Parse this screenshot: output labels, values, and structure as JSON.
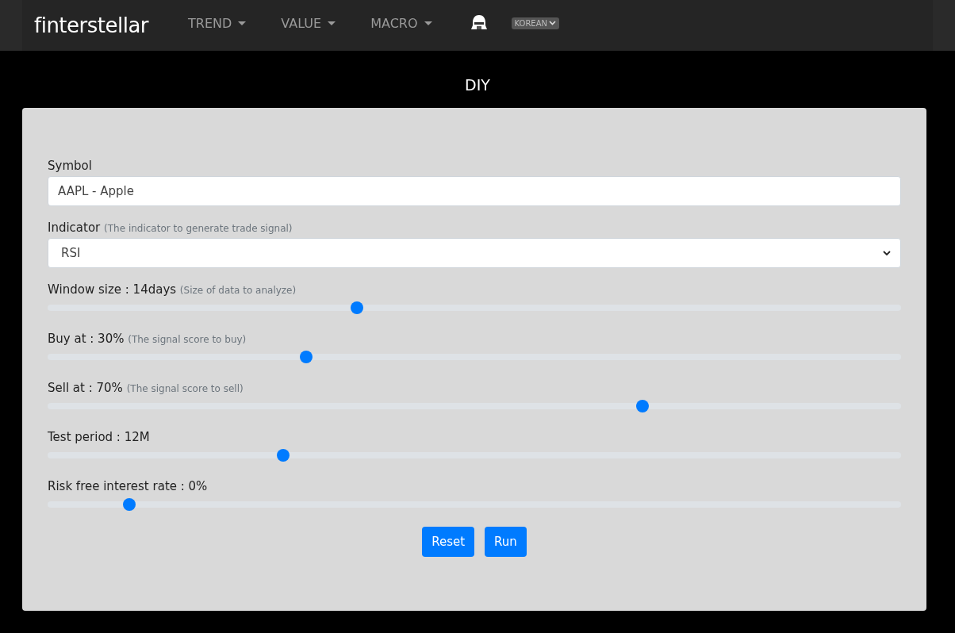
{
  "navbar": {
    "brand": "finterstellar",
    "menus": [
      {
        "label": "TREND"
      },
      {
        "label": "VALUE"
      },
      {
        "label": "MACRO"
      }
    ],
    "language": "KOREAN"
  },
  "page_title": "DIY",
  "form": {
    "symbol": {
      "label": "Symbol",
      "value": "AAPL - Apple"
    },
    "indicator": {
      "label": "Indicator",
      "hint": "(The indicator to generate trade signal)",
      "value": "RSI"
    },
    "sliders": [
      {
        "label": "Window size : 14days",
        "hint": "(Size of data to analyze)",
        "level": 0.36
      },
      {
        "label": "Buy at : 30%",
        "hint": "(The signal score to buy)",
        "level": 0.3
      },
      {
        "label": "Sell at : 70%",
        "hint": "(The signal score to sell)",
        "level": 0.7
      },
      {
        "label": "Test period : 12M",
        "level": 0.273
      },
      {
        "label": "Risk free interest rate : 0%",
        "level": 0.09
      }
    ],
    "buttons": [
      "Reset",
      "Run"
    ]
  }
}
